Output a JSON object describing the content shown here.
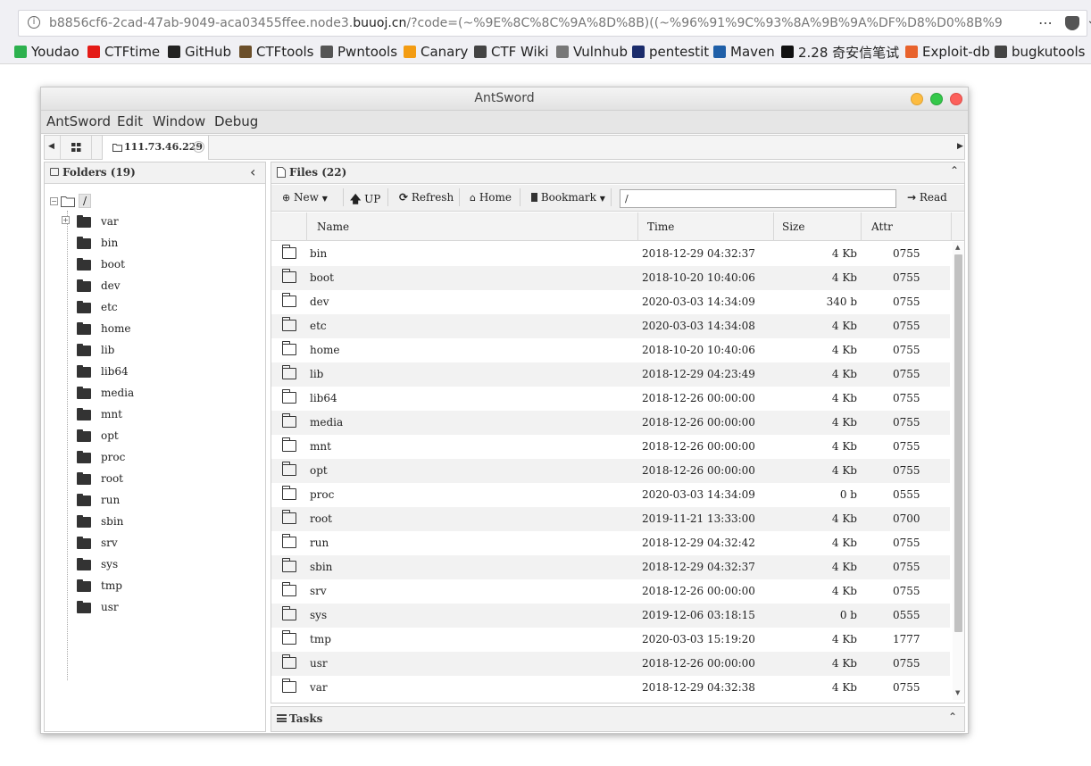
{
  "browser": {
    "url_prefix": "b8856cf6-2cad-47ab-9049-aca03455ffee.node3.",
    "url_domain": "buuoj.cn",
    "url_suffix": "/?code=(~%9E%8C%8C%9A%8D%8B)((~%96%91%9C%93%8A%9B%9A%DF%D8%D0%8B%9",
    "more_icon": "⋯",
    "bookmarks": [
      {
        "label": "Youdao",
        "color": "#2db14e"
      },
      {
        "label": "CTFtime",
        "color": "#e41b17"
      },
      {
        "label": "GitHub",
        "color": "#222222"
      },
      {
        "label": "CTFtools",
        "color": "#6b4f2a"
      },
      {
        "label": "Pwntools",
        "color": "#555555"
      },
      {
        "label": "Canary",
        "color": "#f39c12"
      },
      {
        "label": "CTF Wiki",
        "color": "#444444"
      },
      {
        "label": "Vulnhub",
        "color": "#777777"
      },
      {
        "label": "pentestit",
        "color": "#1a2b6b"
      },
      {
        "label": "Maven",
        "color": "#1f5fa8"
      },
      {
        "label": "2.28 奇安信笔试",
        "color": "#111111"
      },
      {
        "label": "Exploit-db",
        "color": "#e8622c"
      },
      {
        "label": "bugkutools",
        "color": "#444444"
      }
    ]
  },
  "window": {
    "title": "AntSword",
    "menu": [
      "AntSword",
      "Edit",
      "Window",
      "Debug"
    ],
    "tab_label": "111.73.46.229",
    "tab_close": "×",
    "tab_prev": "◀",
    "tab_next": "▶"
  },
  "folders": {
    "title": "Folders (19)",
    "collapse": "‹",
    "root": "/",
    "expand_symbol": "+",
    "items": [
      "var",
      "bin",
      "boot",
      "dev",
      "etc",
      "home",
      "lib",
      "lib64",
      "media",
      "mnt",
      "opt",
      "proc",
      "root",
      "run",
      "sbin",
      "srv",
      "sys",
      "tmp",
      "usr"
    ]
  },
  "files": {
    "title": "Files (22)",
    "collapse": "⌃",
    "toolbar": {
      "new": "New",
      "up": "UP",
      "refresh": "Refresh",
      "home": "Home",
      "bookmark": "Bookmark",
      "path": "/",
      "read": "Read"
    },
    "columns": [
      "Name",
      "Time",
      "Size",
      "Attr"
    ],
    "rows": [
      {
        "name": "bin",
        "time": "2018-12-29 04:32:37",
        "size": "4 Kb",
        "attr": "0755"
      },
      {
        "name": "boot",
        "time": "2018-10-20 10:40:06",
        "size": "4 Kb",
        "attr": "0755"
      },
      {
        "name": "dev",
        "time": "2020-03-03 14:34:09",
        "size": "340 b",
        "attr": "0755"
      },
      {
        "name": "etc",
        "time": "2020-03-03 14:34:08",
        "size": "4 Kb",
        "attr": "0755"
      },
      {
        "name": "home",
        "time": "2018-10-20 10:40:06",
        "size": "4 Kb",
        "attr": "0755"
      },
      {
        "name": "lib",
        "time": "2018-12-29 04:23:49",
        "size": "4 Kb",
        "attr": "0755"
      },
      {
        "name": "lib64",
        "time": "2018-12-26 00:00:00",
        "size": "4 Kb",
        "attr": "0755"
      },
      {
        "name": "media",
        "time": "2018-12-26 00:00:00",
        "size": "4 Kb",
        "attr": "0755"
      },
      {
        "name": "mnt",
        "time": "2018-12-26 00:00:00",
        "size": "4 Kb",
        "attr": "0755"
      },
      {
        "name": "opt",
        "time": "2018-12-26 00:00:00",
        "size": "4 Kb",
        "attr": "0755"
      },
      {
        "name": "proc",
        "time": "2020-03-03 14:34:09",
        "size": "0 b",
        "attr": "0555"
      },
      {
        "name": "root",
        "time": "2019-11-21 13:33:00",
        "size": "4 Kb",
        "attr": "0700"
      },
      {
        "name": "run",
        "time": "2018-12-29 04:32:42",
        "size": "4 Kb",
        "attr": "0755"
      },
      {
        "name": "sbin",
        "time": "2018-12-29 04:32:37",
        "size": "4 Kb",
        "attr": "0755"
      },
      {
        "name": "srv",
        "time": "2018-12-26 00:00:00",
        "size": "4 Kb",
        "attr": "0755"
      },
      {
        "name": "sys",
        "time": "2019-12-06 03:18:15",
        "size": "0 b",
        "attr": "0555"
      },
      {
        "name": "tmp",
        "time": "2020-03-03 15:19:20",
        "size": "4 Kb",
        "attr": "1777"
      },
      {
        "name": "usr",
        "time": "2018-12-26 00:00:00",
        "size": "4 Kb",
        "attr": "0755"
      },
      {
        "name": "var",
        "time": "2018-12-29 04:32:38",
        "size": "4 Kb",
        "attr": "0755"
      }
    ]
  },
  "tasks": {
    "title": "Tasks",
    "collapse": "⌃"
  },
  "colors": {
    "close": "#fc605b",
    "minimize": "#fdbc40",
    "maximize": "#34c84a"
  }
}
